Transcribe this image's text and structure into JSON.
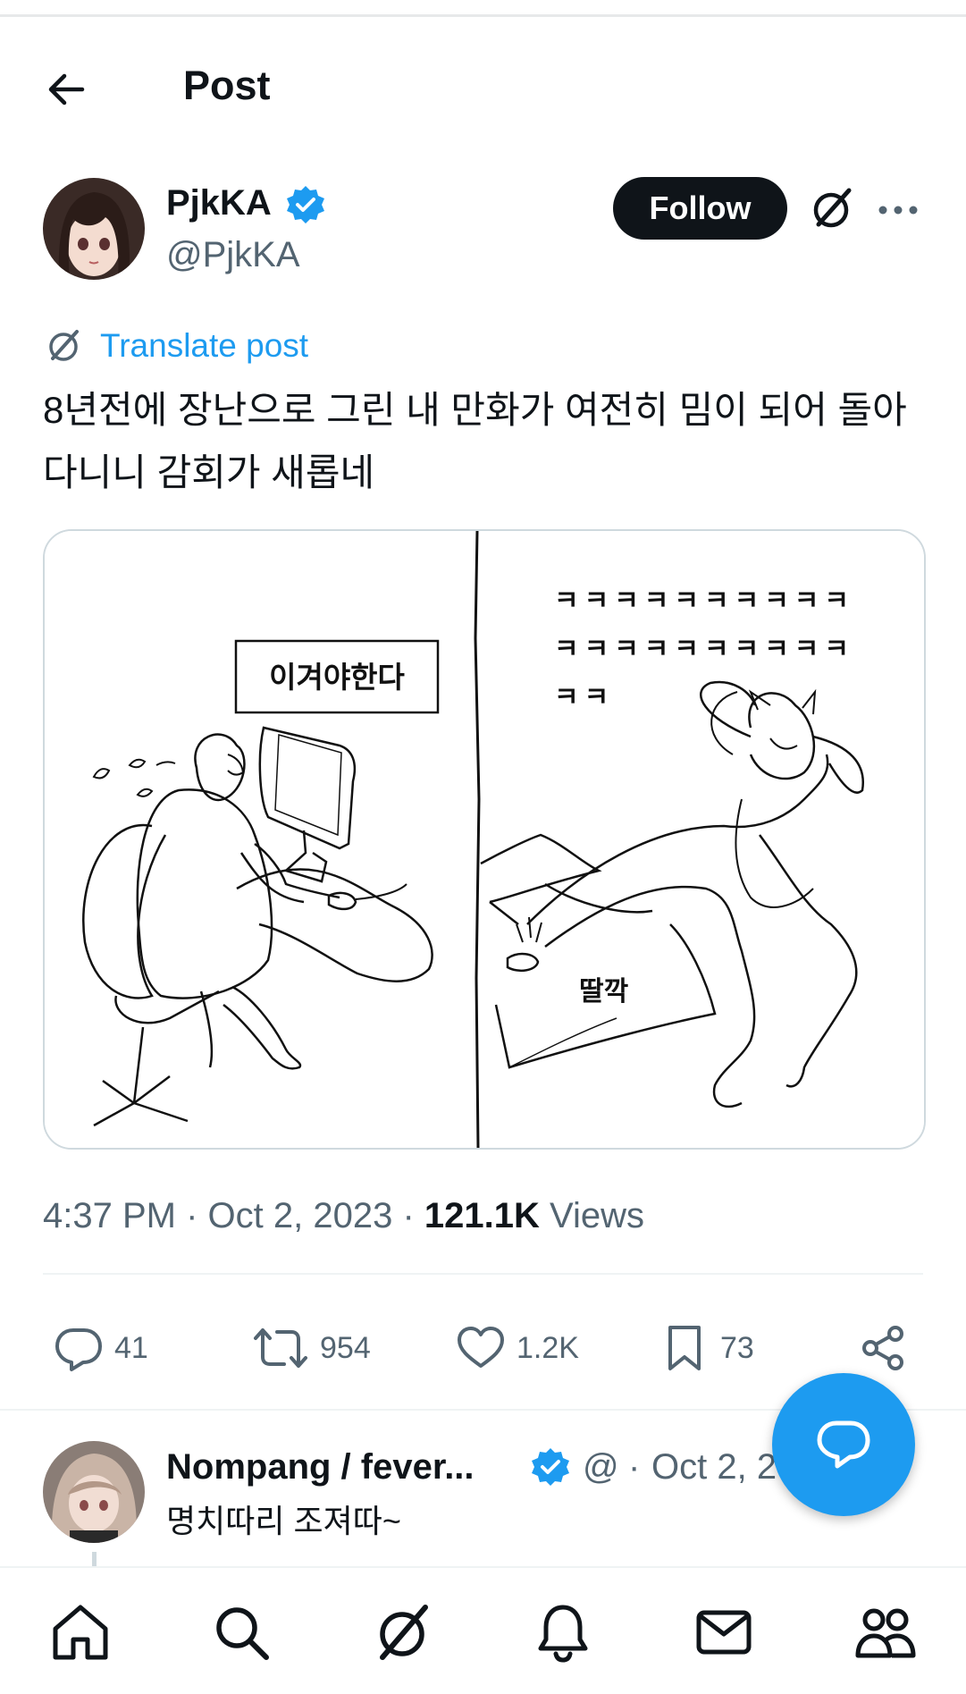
{
  "header": {
    "title": "Post"
  },
  "post": {
    "author_name": "PjkKA",
    "handle": "@PjkKA",
    "follow_label": "Follow",
    "translate_label": "Translate post",
    "text": "8년전에 장난으로 그린 내 만화가 여전히 밈이 되어 돌아다니니 감회가 새롭네",
    "comic": {
      "left_caption": "이겨야한다",
      "right_laugh_line1": "ㅋㅋㅋㅋㅋㅋㅋㅋㅋㅋ",
      "right_laugh_line2": "ㅋㅋㅋㅋㅋㅋㅋㅋㅋㅋ",
      "right_laugh_line3": "ㅋㅋ",
      "click_sound": "딸깍"
    },
    "time": "4:37 PM",
    "date": "Oct 2, 2023",
    "views_count": "121.1K",
    "views_label": "Views"
  },
  "actions": {
    "replies": "41",
    "reposts": "954",
    "likes": "1.2K",
    "bookmarks": "73"
  },
  "reply": {
    "author_name": "Nompang / fever...",
    "handle": "@",
    "separator": "·",
    "date": "Oct 2, 2",
    "text": "명치따리 조져따~"
  },
  "colors": {
    "accent": "#1d9bf0",
    "text_primary": "#0f1419",
    "text_secondary": "#536471",
    "divider": "#eff3f4"
  },
  "icons": {
    "back": "arrow-left-icon",
    "verified": "verified-badge-icon",
    "grok": "grok-icon",
    "more": "more-horizontal-icon",
    "reply": "comment-icon",
    "repost": "repost-icon",
    "like": "heart-icon",
    "bookmark": "bookmark-icon",
    "share": "share-icon",
    "fab": "new-reply-icon",
    "nav": [
      "home-icon",
      "search-icon",
      "grok-icon",
      "notifications-icon",
      "messages-icon",
      "communities-icon"
    ]
  }
}
